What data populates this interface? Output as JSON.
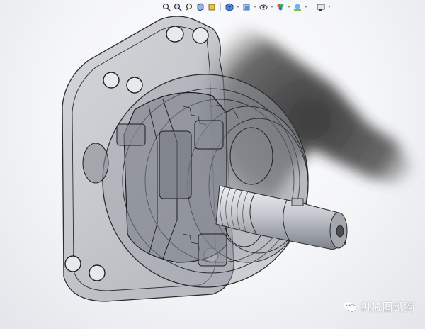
{
  "app": {
    "window_title": "",
    "view_mode": "shaded-with-edges-transparent"
  },
  "heads_up_toolbar": {
    "items": [
      {
        "name": "zoom-to-fit",
        "icon": "zoom-to-fit-icon"
      },
      {
        "name": "zoom-to-area",
        "icon": "zoom-to-area-icon"
      },
      {
        "name": "previous-view",
        "icon": "previous-view-icon"
      },
      {
        "name": "section-view",
        "icon": "section-view-icon"
      },
      {
        "name": "dynamic-annotation",
        "icon": "annotation-icon"
      },
      {
        "name": "view-orientation",
        "icon": "cube-icon",
        "dropdown": true
      },
      {
        "name": "display-style",
        "icon": "display-style-icon",
        "dropdown": true
      },
      {
        "name": "hide-show-items",
        "icon": "eye-icon",
        "dropdown": true
      },
      {
        "name": "edit-appearance",
        "icon": "appearance-icon",
        "dropdown": true
      },
      {
        "name": "apply-scene",
        "icon": "scene-icon",
        "dropdown": true
      },
      {
        "name": "view-settings",
        "icon": "monitor-icon",
        "dropdown": true
      }
    ]
  },
  "model": {
    "description": "gear pump assembly in transparent display mode",
    "colors": {
      "housing_fill": "#9a9ea6",
      "housing_edge": "#2a2c30",
      "shaft": "#c9ccd2",
      "shadow": "#1e1e1e",
      "background_top": "#ffffff",
      "background_bottom": "#e3e5ea"
    }
  },
  "watermark": {
    "icon": "wechat-icon",
    "text": "机械图纸狗"
  }
}
